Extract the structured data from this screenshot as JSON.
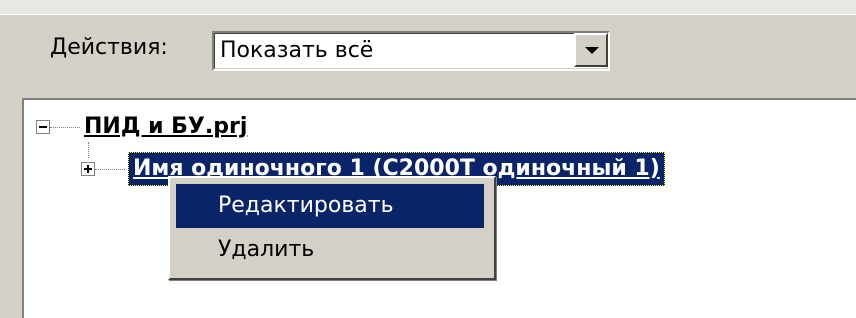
{
  "toolbar": {
    "actions_label": "Действия:",
    "filter_value": "Показать всё"
  },
  "tree": {
    "root_label": "ПИД и БУ.prj",
    "child_label": "Имя одиночного 1 (С2000Т одиночный 1)"
  },
  "context_menu": {
    "items": [
      {
        "label": "Редактировать"
      },
      {
        "label": "Удалить"
      }
    ]
  },
  "colors": {
    "selection": "#0a246a",
    "background": "#d4d0c8"
  }
}
